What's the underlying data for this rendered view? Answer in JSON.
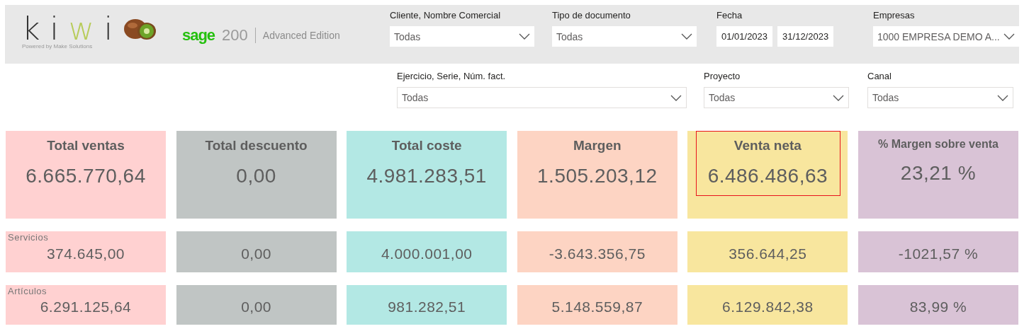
{
  "header": {
    "logo_text": "kiwi",
    "logo_tagline": "Powered by Make Solutions",
    "brand": "sage",
    "version": "200",
    "edition": "Advanced Edition"
  },
  "filters_top": [
    {
      "kind": "dropdown",
      "label": "Cliente, Nombre Comercial",
      "value": "Todas"
    },
    {
      "kind": "dropdown",
      "label": "Tipo de documento",
      "value": "Todas"
    },
    {
      "kind": "date_range",
      "label": "Fecha",
      "from": "01/01/2023",
      "to": "31/12/2023"
    },
    {
      "kind": "dropdown",
      "label": "Empresas",
      "value": "1000 EMPRESA DEMO A..."
    }
  ],
  "filters_bottom": [
    {
      "kind": "dropdown",
      "label": "Ejercicio, Serie, Núm. fact.",
      "value": "Todas"
    },
    {
      "kind": "dropdown",
      "label": "Proyecto",
      "value": "Todas"
    },
    {
      "kind": "dropdown",
      "label": "Canal",
      "value": "Todas"
    }
  ],
  "kpis": [
    {
      "title": "Total ventas",
      "value": "6.665.770,64",
      "color": "#ffd1d1",
      "highlighted": false
    },
    {
      "title": "Total descuento",
      "value": "0,00",
      "color": "#c0c5c4",
      "highlighted": false
    },
    {
      "title": "Total coste",
      "value": "4.981.283,51",
      "color": "#b3e8e4",
      "highlighted": false
    },
    {
      "title": "Margen",
      "value": "1.505.203,12",
      "color": "#fdd4c3",
      "highlighted": false
    },
    {
      "title": "Venta neta",
      "value": "6.486.486,63",
      "color": "#f8e69e",
      "highlighted": true
    },
    {
      "title": "% Margen sobre venta",
      "value": "23,21 %",
      "color": "#d9c3d6",
      "highlighted": false
    }
  ],
  "breakdown": [
    {
      "label": "Servicios",
      "values": [
        "374.645,00",
        "0,00",
        "4.000.001,00",
        "-3.643.356,75",
        "356.644,25",
        "-1021,57 %"
      ]
    },
    {
      "label": "Artículos",
      "values": [
        "6.291.125,64",
        "0,00",
        "981.282,51",
        "5.148.559,87",
        "6.129.842,38",
        "83,99 %"
      ]
    }
  ]
}
